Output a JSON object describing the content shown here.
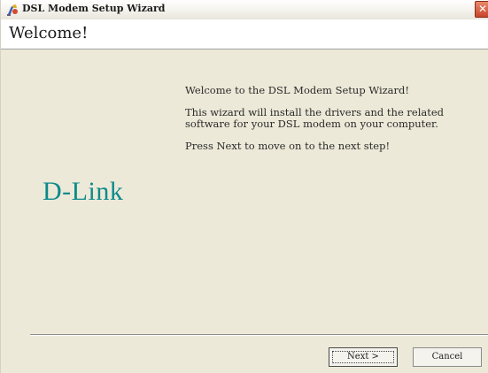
{
  "window": {
    "title": "DSL Modem Setup Wizard",
    "close_glyph": "✕",
    "icon": "wizard-app-icon"
  },
  "header": {
    "title": "Welcome!"
  },
  "side_panel": {
    "logo_text": "D-Link",
    "logo_color": "#0d8a8a"
  },
  "content": {
    "paragraphs": [
      "Welcome to the DSL Modem Setup Wizard!",
      "This wizard will install the drivers and the related software for your DSL modem on your computer.",
      "Press Next to move on to the next step!"
    ]
  },
  "buttons": {
    "next_label": "Next >",
    "cancel_label": "Cancel"
  }
}
